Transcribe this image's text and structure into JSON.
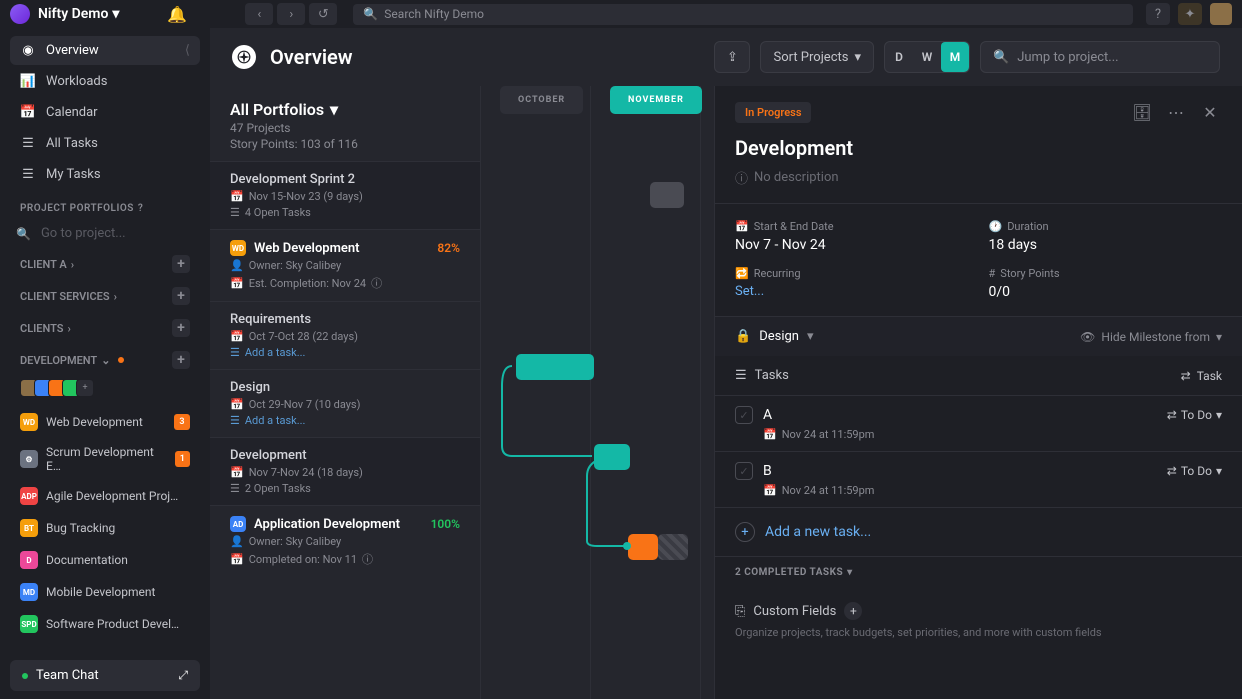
{
  "top": {
    "workspace": "Nifty Demo",
    "search_placeholder": "Search Nifty Demo"
  },
  "sidebar": {
    "nav": [
      {
        "label": "Overview",
        "icon": "compass"
      },
      {
        "label": "Workloads",
        "icon": "chart"
      },
      {
        "label": "Calendar",
        "icon": "calendar"
      },
      {
        "label": "All Tasks",
        "icon": "list"
      },
      {
        "label": "My Tasks",
        "icon": "list"
      }
    ],
    "portfolios_header": "PROJECT PORTFOLIOS",
    "project_placeholder": "Go to project...",
    "portfolios": [
      {
        "label": "CLIENT A"
      },
      {
        "label": "CLIENT SERVICES"
      },
      {
        "label": "CLIENTS"
      },
      {
        "label": "DEVELOPMENT"
      }
    ],
    "projects": [
      {
        "label": "Web Development",
        "badge": "WD",
        "color": "#f59e0b",
        "count": "3"
      },
      {
        "label": "Scrum Development E…",
        "badge": "⚙",
        "color": "#6b7280",
        "count": "1"
      },
      {
        "label": "Agile Development Proj…",
        "badge": "ADP",
        "color": "#ef4444"
      },
      {
        "label": "Bug Tracking",
        "badge": "BT",
        "color": "#f59e0b"
      },
      {
        "label": "Documentation",
        "badge": "D",
        "color": "#ec4899"
      },
      {
        "label": "Mobile Development",
        "badge": "MD",
        "color": "#3b82f6"
      },
      {
        "label": "Software Product Devel…",
        "badge": "SPD",
        "color": "#22c55e"
      }
    ],
    "team_chat": "Team Chat"
  },
  "header": {
    "title": "Overview",
    "sort": "Sort Projects",
    "views": [
      "D",
      "W",
      "M"
    ],
    "jump_placeholder": "Jump to project..."
  },
  "portfolio": {
    "title": "All Portfolios",
    "sub1": "47 Projects",
    "sub2": "Story Points: 103 of 116"
  },
  "months": [
    "OCTOBER",
    "NOVEMBER"
  ],
  "rows": [
    {
      "title": "Development Sprint 2",
      "date": "Nov 15-Nov 23 (9 days)",
      "tasks": "4 Open Tasks"
    },
    {
      "title": "Web Development",
      "owner": "Owner: Sky Calibey",
      "est": "Est. Completion: Nov 24",
      "pct": "82%",
      "badge": "WD",
      "color": "#f59e0b",
      "big": true
    },
    {
      "title": "Requirements",
      "date": "Oct 7-Oct 28 (22 days)",
      "add": "Add a task..."
    },
    {
      "title": "Design",
      "date": "Oct 29-Nov 7 (10 days)",
      "add": "Add a task..."
    },
    {
      "title": "Development",
      "date": "Nov 7-Nov 24 (18 days)",
      "tasks": "2 Open Tasks",
      "active": true
    },
    {
      "title": "Application Development",
      "owner": "Owner: Sky Calibey",
      "est": "Completed on: Nov 11",
      "pct": "100%",
      "badge": "AD",
      "color": "#3b82f6",
      "big": true,
      "done": true
    }
  ],
  "panel": {
    "status": "In Progress",
    "title": "Development",
    "desc": "No description",
    "start_end_lbl": "Start & End Date",
    "start_end_val": "Nov 7 - Nov 24",
    "duration_lbl": "Duration",
    "duration_val": "18 days",
    "recurring_lbl": "Recurring",
    "recurring_val": "Set...",
    "points_lbl": "Story Points",
    "points_val": "0/0",
    "section": "Design",
    "hide": "Hide Milestone from",
    "tasks_lbl": "Tasks",
    "task_btn": "Task",
    "tasks": [
      {
        "name": "A",
        "due": "Nov 24 at 11:59pm",
        "status": "To Do"
      },
      {
        "name": "B",
        "due": "Nov 24 at 11:59pm",
        "status": "To Do"
      }
    ],
    "add_task": "Add a new task...",
    "completed": "2 COMPLETED TASKS",
    "custom": "Custom Fields",
    "custom_sub": "Organize projects, track budgets, set priorities, and more with custom fields"
  }
}
